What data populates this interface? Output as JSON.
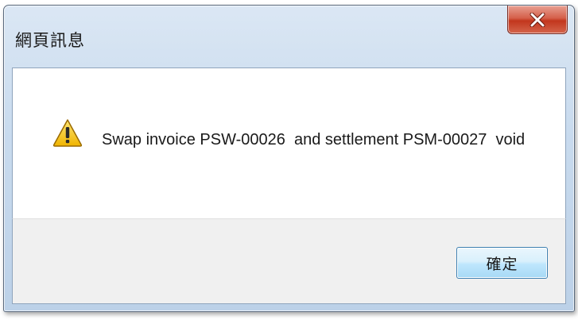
{
  "window": {
    "title": "網頁訊息",
    "close_icon": "close-x-icon"
  },
  "dialog": {
    "icon": "warning-icon",
    "message": "Swap invoice PSW-00026  and settlement PSM-00027  void",
    "ok_label": "確定"
  },
  "colors": {
    "close_button": "#c9452e",
    "warning_fill": "#f5c21b",
    "ok_button_border": "#3c7fb1"
  }
}
